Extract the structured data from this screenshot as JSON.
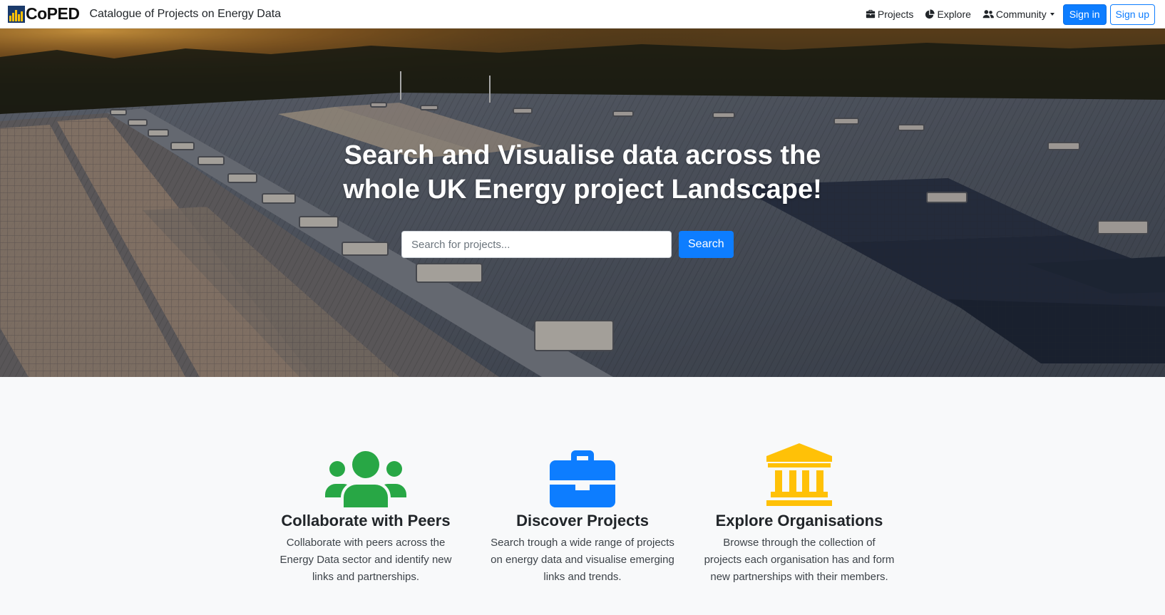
{
  "navbar": {
    "brand_name": "CoPED",
    "brand_subtitle": "Catalogue of Projects on Energy Data",
    "links": [
      {
        "label": "Projects",
        "icon": "briefcase-icon"
      },
      {
        "label": "Explore",
        "icon": "chart-pie-icon"
      },
      {
        "label": "Community",
        "icon": "users-icon"
      }
    ],
    "signin_label": "Sign in",
    "signup_label": "Sign up"
  },
  "hero": {
    "title_line1": "Search and Visualise data across the",
    "title_line2": "whole UK Energy project Landscape!",
    "search_placeholder": "Search for projects...",
    "search_button": "Search"
  },
  "features": [
    {
      "icon": "users-icon",
      "color": "#28a745",
      "title": "Collaborate with Peers",
      "text": "Collaborate with peers across the Energy Data sector and identify new links and partnerships."
    },
    {
      "icon": "briefcase-icon",
      "color": "#0d7dff",
      "title": "Discover Projects",
      "text": "Search trough a wide range of projects on energy data and visualise emerging links and trends."
    },
    {
      "icon": "landmark-icon",
      "color": "#ffc107",
      "title": "Explore Organisations",
      "text": "Browse through the collection of projects each organisation has and form new partnerships with their members."
    }
  ]
}
